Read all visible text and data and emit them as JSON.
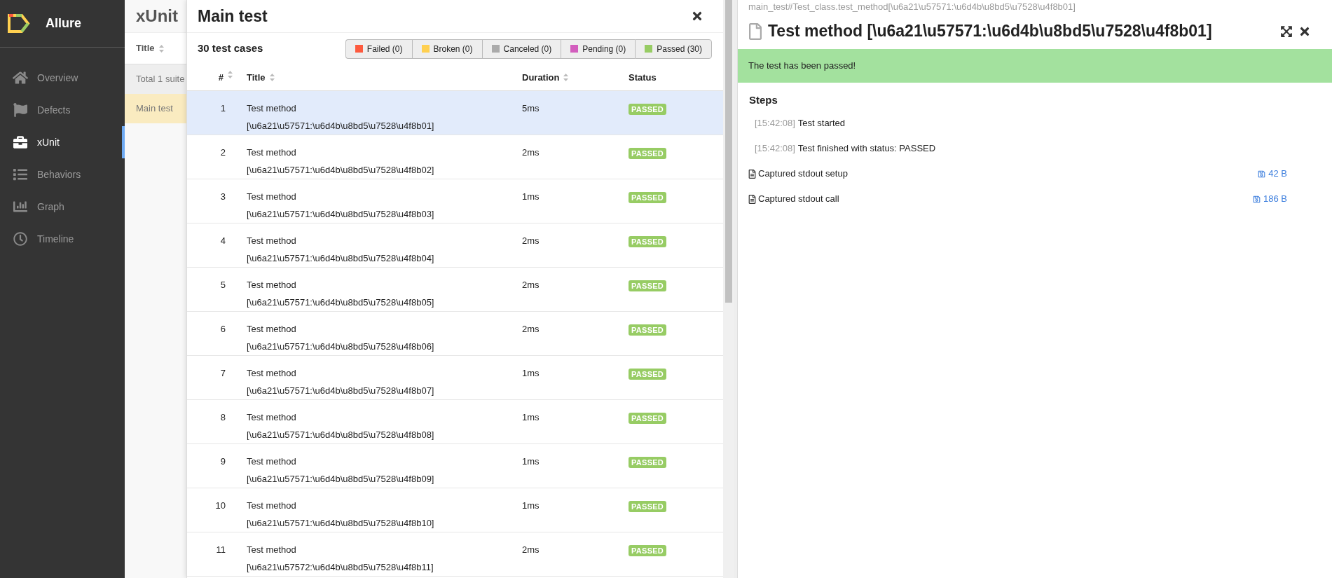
{
  "sidebar": {
    "app_name": "Allure",
    "items": [
      {
        "label": "Overview",
        "kind": "home",
        "selected": false
      },
      {
        "label": "Defects",
        "kind": "flag",
        "selected": false
      },
      {
        "label": "xUnit",
        "kind": "briefcase",
        "selected": true
      },
      {
        "label": "Behaviors",
        "kind": "list",
        "selected": false
      },
      {
        "label": "Graph",
        "kind": "chart",
        "selected": false
      },
      {
        "label": "Timeline",
        "kind": "clock",
        "selected": false
      }
    ]
  },
  "xunit_panel": {
    "title": "xUnit",
    "column": "Title",
    "total": "Total 1 suite",
    "suites": [
      {
        "label": "Main test",
        "selected": true
      }
    ]
  },
  "suite_panel": {
    "title": "Main test",
    "count": "30 test cases",
    "filters": [
      {
        "label": "Failed (0)",
        "color": "#fd5a3e"
      },
      {
        "label": "Broken (0)",
        "color": "#ffd050"
      },
      {
        "label": "Canceled (0)",
        "color": "#aaaaaa"
      },
      {
        "label": "Pending (0)",
        "color": "#d35ebe"
      },
      {
        "label": "Passed (30)",
        "color": "#97cc64"
      }
    ],
    "columns": [
      "#",
      "Title",
      "Duration",
      "Status"
    ],
    "rows": [
      {
        "num": "1",
        "title": "Test method [\\u6a21\\u57571:\\u6d4b\\u8bd5\\u7528\\u4f8b01]",
        "duration": "5ms",
        "status": "PASSED",
        "kind": "passed",
        "selected": true
      },
      {
        "num": "2",
        "title": "Test method [\\u6a21\\u57571:\\u6d4b\\u8bd5\\u7528\\u4f8b02]",
        "duration": "2ms",
        "status": "PASSED",
        "kind": "passed",
        "selected": false
      },
      {
        "num": "3",
        "title": "Test method [\\u6a21\\u57571:\\u6d4b\\u8bd5\\u7528\\u4f8b03]",
        "duration": "1ms",
        "status": "PASSED",
        "kind": "passed",
        "selected": false
      },
      {
        "num": "4",
        "title": "Test method [\\u6a21\\u57571:\\u6d4b\\u8bd5\\u7528\\u4f8b04]",
        "duration": "2ms",
        "status": "PASSED",
        "kind": "passed",
        "selected": false
      },
      {
        "num": "5",
        "title": "Test method [\\u6a21\\u57571:\\u6d4b\\u8bd5\\u7528\\u4f8b05]",
        "duration": "2ms",
        "status": "PASSED",
        "kind": "passed",
        "selected": false
      },
      {
        "num": "6",
        "title": "Test method [\\u6a21\\u57571:\\u6d4b\\u8bd5\\u7528\\u4f8b06]",
        "duration": "2ms",
        "status": "PASSED",
        "kind": "passed",
        "selected": false
      },
      {
        "num": "7",
        "title": "Test method [\\u6a21\\u57571:\\u6d4b\\u8bd5\\u7528\\u4f8b07]",
        "duration": "1ms",
        "status": "PASSED",
        "kind": "passed",
        "selected": false
      },
      {
        "num": "8",
        "title": "Test method [\\u6a21\\u57571:\\u6d4b\\u8bd5\\u7528\\u4f8b08]",
        "duration": "1ms",
        "status": "PASSED",
        "kind": "passed",
        "selected": false
      },
      {
        "num": "9",
        "title": "Test method [\\u6a21\\u57571:\\u6d4b\\u8bd5\\u7528\\u4f8b09]",
        "duration": "1ms",
        "status": "PASSED",
        "kind": "passed",
        "selected": false
      },
      {
        "num": "10",
        "title": "Test method [\\u6a21\\u57571:\\u6d4b\\u8bd5\\u7528\\u4f8b10]",
        "duration": "1ms",
        "status": "PASSED",
        "kind": "passed",
        "selected": false
      },
      {
        "num": "11",
        "title": "Test method [\\u6a21\\u57572:\\u6d4b\\u8bd5\\u7528\\u4f8b11]",
        "duration": "2ms",
        "status": "PASSED",
        "kind": "passed",
        "selected": false
      }
    ]
  },
  "detail": {
    "path": "main_test#Test_class.test_method[\\u6a21\\u57571:\\u6d4b\\u8bd5\\u7528\\u4f8b01]",
    "title": "Test method [\\u6a21\\u57571:\\u6d4b\\u8bd5\\u7528\\u4f8b01]",
    "kind": "passed",
    "status_message": "The test has been passed!",
    "steps_heading": "Steps",
    "steps": [
      {
        "time": "[15:42:08]",
        "text": "Test started"
      },
      {
        "time": "[15:42:08]",
        "text": "Test finished with status: PASSED"
      }
    ],
    "attachments": [
      {
        "name": "Captured stdout setup",
        "size": "42 B"
      },
      {
        "name": "Captured stdout call",
        "size": "186 B"
      }
    ]
  }
}
